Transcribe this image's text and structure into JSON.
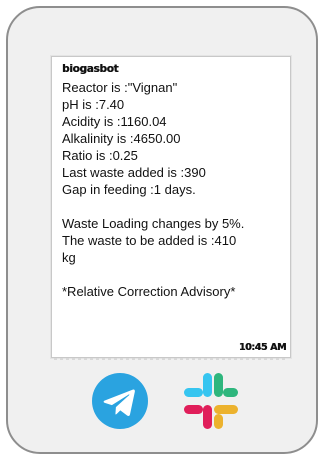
{
  "message": {
    "sender": "biogasbot",
    "lines": [
      "Reactor is :\"Vignan\"",
      "pH is :7.40",
      "Acidity is :1160.04",
      "Alkalinity is :4650.00",
      "Ratio is :0.25",
      "Last waste added is :390",
      "Gap in feeding :1 days.",
      "Waste Loading changes by 5%.",
      "The waste to be added is :410",
      "kg",
      "*Relative Correction Advisory*"
    ],
    "time": "10:45 AM"
  },
  "icons": {
    "telegram": "telegram-icon",
    "slack": "slack-icon"
  },
  "colors": {
    "telegram": "#2AA3E0",
    "slack_blue": "#36C5F0",
    "slack_green": "#2EB67D",
    "slack_red": "#E01E5A",
    "slack_yellow": "#ECB22E",
    "device_frame": "#8e8e8e",
    "device_bg": "#f0f0f0"
  }
}
